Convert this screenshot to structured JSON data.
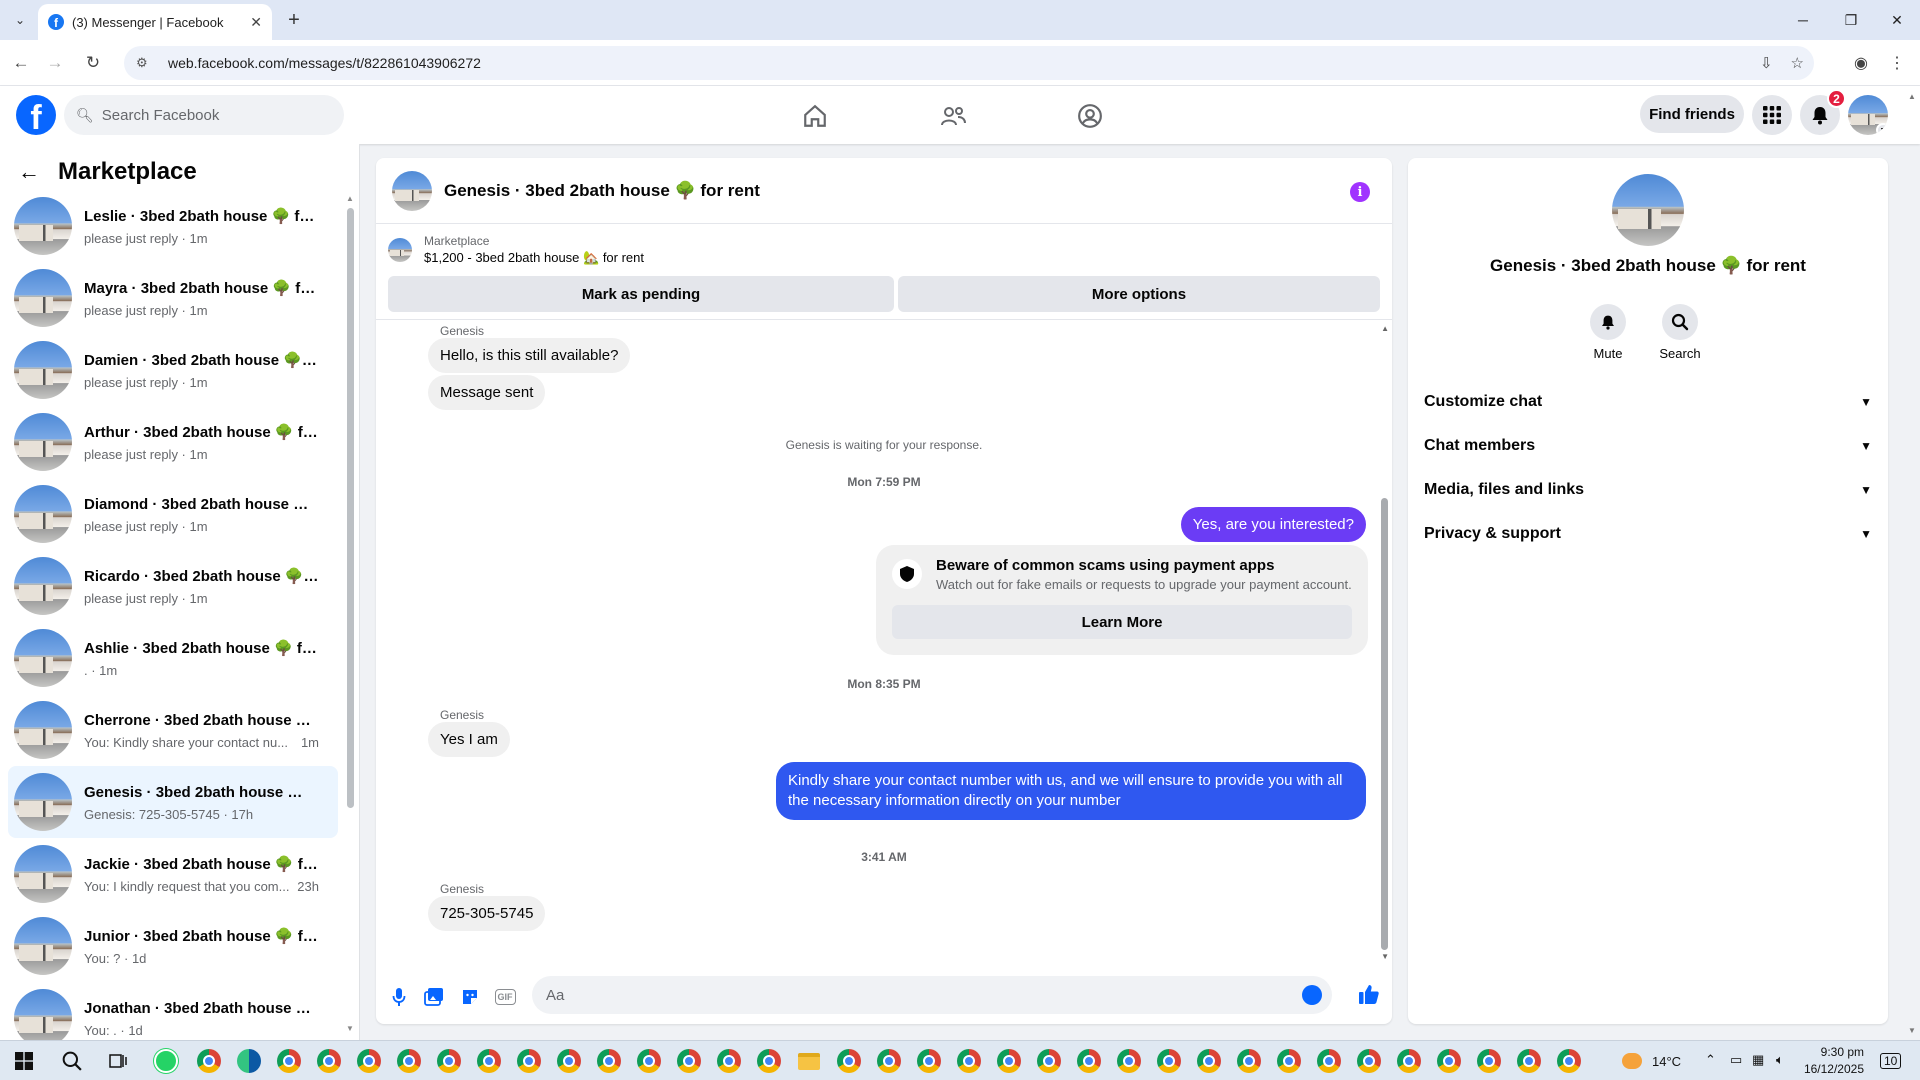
{
  "browser": {
    "tab_title": "(3) Messenger | Facebook",
    "url": "web.facebook.com/messages/t/822861043906272"
  },
  "header": {
    "search_placeholder": "Search Facebook",
    "find_friends": "Find friends",
    "notif_count": "2"
  },
  "sidebar": {
    "title": "Marketplace",
    "conversations": [
      {
        "name": "Leslie · 3bed 2bath house 🌳 for...",
        "snippet": "please just reply · 1m",
        "time": ""
      },
      {
        "name": "Mayra · 3bed 2bath house 🌳 fo...",
        "snippet": "please just reply · 1m",
        "time": ""
      },
      {
        "name": "Damien · 3bed 2bath house 🌳 f...",
        "snippet": "please just reply · 1m",
        "time": ""
      },
      {
        "name": "Arthur · 3bed 2bath house 🌳 fo...",
        "snippet": "please just reply · 1m",
        "time": ""
      },
      {
        "name": "Diamond · 3bed 2bath house 🌳 ...",
        "snippet": "please just reply · 1m",
        "time": ""
      },
      {
        "name": "Ricardo · 3bed 2bath house 🌳 f...",
        "snippet": "please just reply · 1m",
        "time": ""
      },
      {
        "name": "Ashlie · 3bed 2bath house 🌳 fo...",
        "snippet": ". · 1m",
        "time": ""
      },
      {
        "name": "Cherrone · 3bed 2bath house 🌳 ...",
        "snippet": "You: Kindly share your contact nu...",
        "time": "1m"
      },
      {
        "name": "Genesis · 3bed 2bath house 🌳 f...",
        "snippet": "Genesis: 725-305-5745 · 17h",
        "time": ""
      },
      {
        "name": "Jackie · 3bed 2bath house 🌳 fo...",
        "snippet": "You: I kindly request that you com...",
        "time": "23h"
      },
      {
        "name": "Junior · 3bed 2bath house 🌳 fo...",
        "snippet": "You: ? · 1d",
        "time": ""
      },
      {
        "name": "Jonathan · 3bed 2bath house 🌳 ...",
        "snippet": "You: . · 1d",
        "time": ""
      }
    ]
  },
  "chat": {
    "title": "Genesis · 3bed 2bath house 🌳 for rent",
    "listing_label": "Marketplace",
    "listing_price": "$1,200 - 3bed 2bath house 🏡 for rent",
    "mark_pending": "Mark as pending",
    "more_options": "More options",
    "sender1": "Genesis",
    "msg1": "Hello, is this still available?",
    "msg2": "Message sent",
    "waiting": "Genesis is waiting for your response.",
    "stamp1": "Mon 7:59 PM",
    "out1": "Yes, are you interested?",
    "scam_title": "Beware of common scams using payment apps",
    "scam_sub": "Watch out for fake emails or requests to upgrade your payment account.",
    "learn_more": "Learn More",
    "stamp2": "Mon 8:35 PM",
    "sender2": "Genesis",
    "msg3": "Yes I am",
    "out2": "Kindly share your contact number with us, and we will ensure to provide you with all the necessary information directly on your number",
    "stamp3": "3:41 AM",
    "sender3": "Genesis",
    "msg4": "725-305-5745",
    "composer_placeholder": "Aa",
    "out_color": "#6b3cf5",
    "out_color2": "#2f58f0"
  },
  "details": {
    "title": "Genesis · 3bed 2bath house 🌳 for rent",
    "mute": "Mute",
    "search": "Search",
    "sections": [
      "Customize chat",
      "Chat members",
      "Media, files and links",
      "Privacy & support"
    ]
  },
  "taskbar": {
    "temp": "14°C",
    "time": "9:30 pm",
    "date": "16/12/2025",
    "notif": "10"
  }
}
